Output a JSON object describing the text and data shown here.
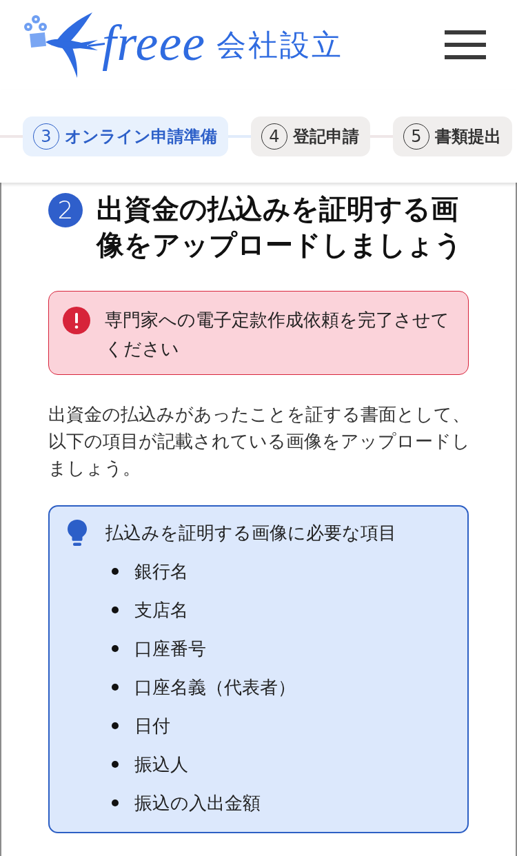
{
  "header": {
    "logo": {
      "brand": "freee",
      "product": "会社設立"
    }
  },
  "steps": [
    {
      "number": "3",
      "label": "オンライン申請準備",
      "selected": true
    },
    {
      "number": "4",
      "label": "登記申請",
      "selected": false
    },
    {
      "number": "5",
      "label": "書類提出",
      "selected": false
    }
  ],
  "section": {
    "number": "2",
    "title": "出資金の払込みを証明する画像をアップロードしましょう",
    "alert": {
      "kind": "error",
      "message": "専門家への電子定款作成依頼を完了させてください"
    },
    "description": "出資金の払込みがあったことを証する書面として、以下の項目が記載されている画像をアップロードしましょう。",
    "info": {
      "title": "払込みを証明する画像に必要な項目",
      "items": [
        "銀行名",
        "支店名",
        "口座番号",
        "口座名義（代表者）",
        "日付",
        "振込人",
        "振込の入出金額"
      ]
    }
  }
}
